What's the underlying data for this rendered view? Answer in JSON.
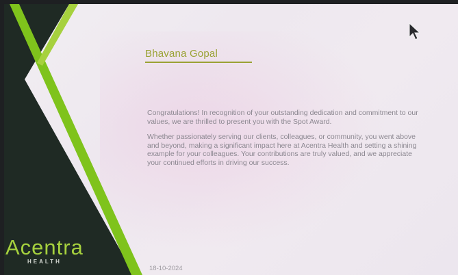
{
  "certificate": {
    "recipient_name": "Bhavana Gopal",
    "paragraph_1": "Congratulations! In recognition of your outstanding dedication and commitment to our values, we are thrilled to present you with the Spot Award.",
    "paragraph_2": "Whether passionately serving our clients, colleagues, or community, you went above and beyond, making a significant impact here at Acentra Health and setting a shining example for your colleagues. Your contributions are truly valued, and we appreciate your continued efforts in driving our success.",
    "date": "18-10-2024"
  },
  "logo": {
    "name": "Acentra",
    "subtitle": "HEALTH"
  },
  "icons": {
    "cursor": "mouse-pointer-icon"
  },
  "colors": {
    "dark_panel": "#1f2a24",
    "accent_green": "#7fc31c",
    "lime": "#a6d13e",
    "name_olive": "#9aa233"
  }
}
